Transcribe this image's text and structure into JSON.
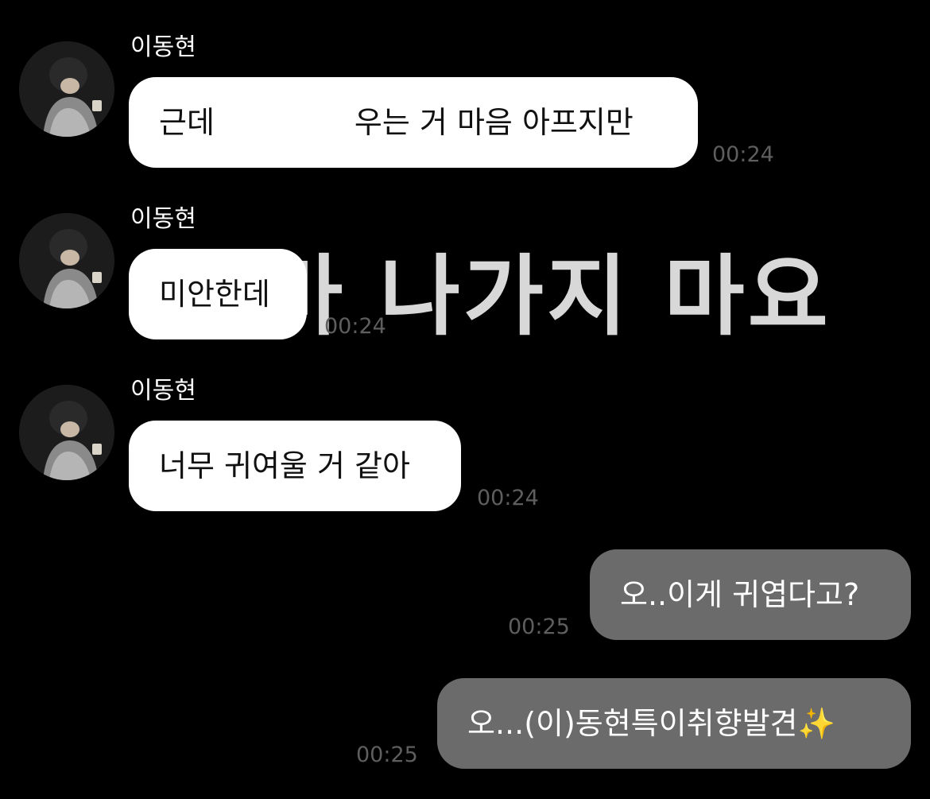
{
  "overlay_text": "마 나가지 마요",
  "messages": [
    {
      "sender": "이동현",
      "text_before": "근데",
      "text_after": "우는 거 마음 아프지만",
      "time": "00:24"
    },
    {
      "sender": "이동현",
      "text": "미안한데",
      "time": "00:24"
    },
    {
      "sender": "이동현",
      "text": "너무 귀여울 거 같아",
      "time": "00:24"
    },
    {
      "text": "오..이게 귀엽다고?",
      "time": "00:25"
    },
    {
      "text": "오...(이)동현특이취향발견",
      "emoji": "✨",
      "time": "00:25"
    }
  ]
}
